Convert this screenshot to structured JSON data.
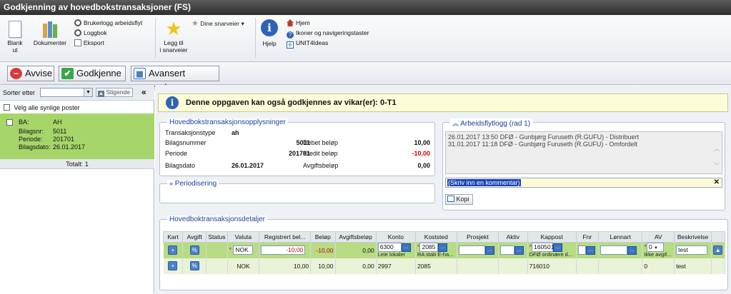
{
  "window": {
    "title": "Godkjenning av hovedbokstransaksjoner (FS)"
  },
  "ribbon": {
    "blank_label_1": "Blank",
    "blank_label_2": "ut",
    "documents_label": "Dokumenter",
    "userlog_label": "Brukerlogg arbeidsflyt",
    "logbook_label": "Loggbok",
    "export_label": "Eksport",
    "add_shortcut_label_1": "Legg til",
    "add_shortcut_label_2": "i snarveier",
    "your_shortcuts_label": "Dine snarveier",
    "help_label": "Hjelp",
    "home_label": "Hjem",
    "icons_nav_label": "Ikoner og navigeringstaster",
    "ideas_label": "UNIT4Ideas"
  },
  "actions": {
    "reject_label": "Avvise",
    "approve_label": "Godkjenne",
    "advanced_label": "Avansert modus"
  },
  "leftpane": {
    "sort_label": "Sorter etter",
    "sort_value": "",
    "ascending_label": "Stigende",
    "select_all_label": "Velg alle synlige poster",
    "item": {
      "ba_label": "BA:",
      "ba_value": "AH",
      "voucher_label": "Bilagsnr:",
      "voucher_value": "5011",
      "period_label": "Periode:",
      "period_value": "201701",
      "date_label": "Bilagsdato:",
      "date_value": "26.01.2017"
    },
    "total_label": "Totalt: 1"
  },
  "notice": {
    "text": "Denne oppgaven kan også godkjennes av vikar(er): 0-T1"
  },
  "info_panel": {
    "title": "Hovedbokstransaksjonsopplysninger",
    "type_label": "Transaksjonstype",
    "type_value": "ah",
    "voucher_label": "Bilagsnummer",
    "voucher_value": "5011",
    "period_label": "Periode",
    "period_value": "201701",
    "date_label": "Bilagsdato",
    "date_value": "26.01.2017",
    "debit_label": "Debet beløp",
    "debit_value": "10,00",
    "credit_label": "Kredit beløp",
    "credit_value": "-10,00",
    "fee_label": "Avgiftsbeløp",
    "fee_value": "0,00"
  },
  "periodisering": {
    "title": "Periodisering"
  },
  "workflow": {
    "title": "Arbeidsflytlogg (rad 1)",
    "log": [
      "26.01.2017 13:50 DFØ - Gunbjørg Furuseth (R.GUFU) - Distribuert",
      "31.01.2017 11:18 DFØ - Gunbjørg Furuseth (R.GUFU) - Omfordelt"
    ],
    "comment_placeholder": "(Skriv inn en kommentar)",
    "copy_label": "Kopi"
  },
  "details": {
    "title": "Hovedboktransaksjonsdetaljer",
    "columns": [
      "Kart",
      "Avgift",
      "Status",
      "Valuta",
      "Registrert bel...",
      "Beløp",
      "Avgiftsbeløp",
      "Konto",
      "Koststed",
      "Prosjekt",
      "Aktiv",
      "Kappost",
      "Fnr",
      "Lønnart",
      "AV",
      "Beskrivelse"
    ],
    "rows": [
      {
        "valuta": "NOK",
        "registrert": "-10,00",
        "belop": "-10,00",
        "avgiftsbelop": "0,00",
        "konto": "6300",
        "konto_desc": "Leie lokaler",
        "koststed": "2085",
        "koststed_desc": "RA stab E-ha...",
        "kappost": "160501",
        "kappost_desc": "DFØ ordinære d...",
        "av": "0",
        "av_desc": "Ikke avgif...",
        "beskrivelse": "test"
      },
      {
        "valuta": "NOK",
        "registrert": "10,00",
        "belop": "10,00",
        "avgiftsbelop": "0,00",
        "konto": "2997",
        "koststed": "2085",
        "kappost": "716010",
        "av": "0",
        "beskrivelse": "test"
      }
    ]
  },
  "colors": {
    "accent_green": "#a6d66a",
    "title_blue": "#1a3fa0",
    "negative_red": "#cc0000"
  }
}
